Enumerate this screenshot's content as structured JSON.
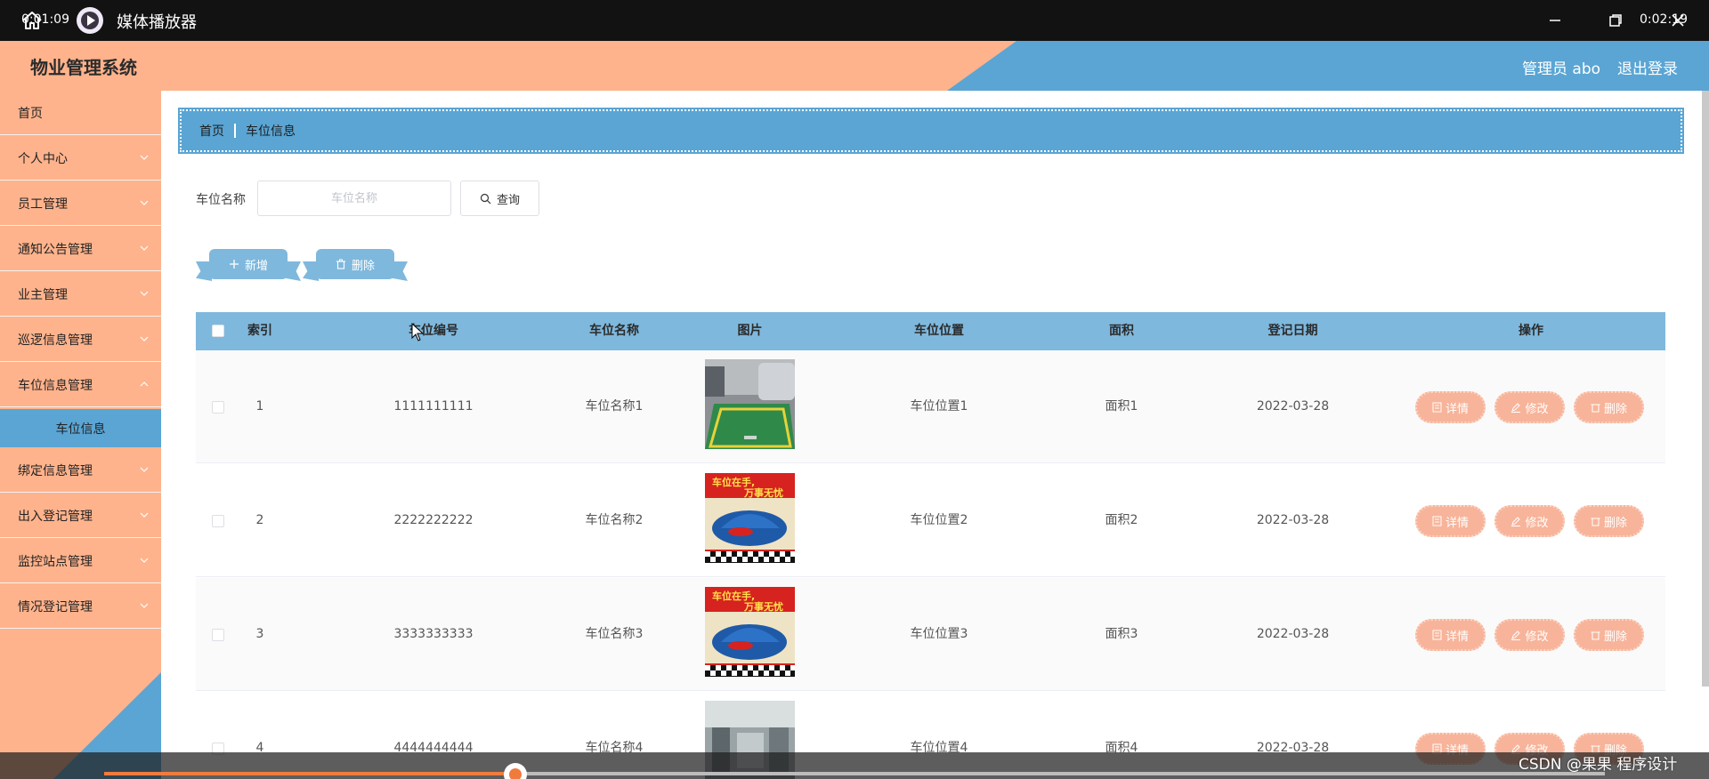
{
  "player": {
    "title": "媒体播放器",
    "time_current": "0:01:09",
    "time_total": "0:02:19",
    "progress": 0.274,
    "watermark": "CSDN @果果 程序设计"
  },
  "app": {
    "title": "物业管理系统",
    "admin_label": "管理员 abo",
    "logout_label": "退出登录",
    "colors": {
      "accent": "#5aa5d4",
      "sidebar": "#ffb38c",
      "table_header": "#7fb8dd",
      "op_button": "#f7b49a"
    }
  },
  "sidebar": {
    "items": [
      {
        "label": "首页",
        "has_chevron": false
      },
      {
        "label": "个人中心",
        "has_chevron": true
      },
      {
        "label": "员工管理",
        "has_chevron": true
      },
      {
        "label": "通知公告管理",
        "has_chevron": true
      },
      {
        "label": "业主管理",
        "has_chevron": true
      },
      {
        "label": "巡逻信息管理",
        "has_chevron": true
      },
      {
        "label": "车位信息管理",
        "has_chevron": true,
        "expanded": true
      },
      {
        "label": "绑定信息管理",
        "has_chevron": true
      },
      {
        "label": "出入登记管理",
        "has_chevron": true
      },
      {
        "label": "监控站点管理",
        "has_chevron": true
      },
      {
        "label": "情况登记管理",
        "has_chevron": true
      }
    ],
    "active_sub": "车位信息"
  },
  "breadcrumb": {
    "home": "首页",
    "current": "车位信息"
  },
  "search": {
    "label": "车位名称",
    "placeholder": "车位名称",
    "query_label": "查询"
  },
  "toolbar": {
    "add_label": "新增",
    "delete_label": "删除"
  },
  "table": {
    "columns": [
      "索引",
      "车位编号",
      "车位名称",
      "图片",
      "车位位置",
      "面积",
      "登记日期",
      "操作"
    ],
    "actions": {
      "detail": "详情",
      "edit": "修改",
      "delete": "删除"
    },
    "image_caption": "车位在手，万事无忧",
    "rows": [
      {
        "index": "1",
        "code": "1111111111",
        "name": "车位名称1",
        "image": "parking-spot",
        "location": "车位位置1",
        "area": "面积1",
        "date": "2022-03-28"
      },
      {
        "index": "2",
        "code": "2222222222",
        "name": "车位名称2",
        "image": "car-cover-poster",
        "location": "车位位置2",
        "area": "面积2",
        "date": "2022-03-28"
      },
      {
        "index": "3",
        "code": "3333333333",
        "name": "车位名称3",
        "image": "car-cover-poster",
        "location": "车位位置3",
        "area": "面积3",
        "date": "2022-03-28"
      },
      {
        "index": "4",
        "code": "4444444444",
        "name": "车位名称4",
        "image": "garage-interior",
        "location": "车位位置4",
        "area": "面积4",
        "date": "2022-03-28"
      }
    ]
  }
}
